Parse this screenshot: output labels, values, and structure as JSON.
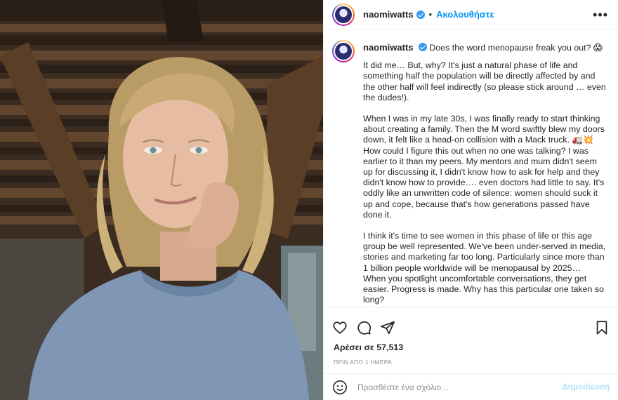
{
  "post": {
    "username": "naomiwatts",
    "follow_label": "Ακολουθήστε",
    "dot": "•",
    "more": "•••"
  },
  "caption": {
    "username": "naomiwatts",
    "first_line": "Does the word menopause freak you out? 😱",
    "paragraphs": [
      "It did me… But, why? It's just a natural phase of life and something half the population will be directly affected by and the other half will feel indirectly (so please stick around … even the dudes!).",
      "When I was in my late 30s, I was finally ready to start thinking about creating a family. Then the M word swiftly blew my doors down, it felt like a head-on collision with a Mack truck. 🚛💥 How could I figure this out when no one was talking? I was earlier to it than my peers. My mentors and mum didn't seem up for discussing it, I didn't know how to ask for help and they didn't know how to provide…. even doctors had little to say. It's oddly like an unwritten code of silence: women should suck it up and cope, because that's how generations passed have done it.",
      "I think it's time to see women in this phase of life or this age group be well represented. We've been under-served in media, stories and marketing far too long. Particularly since more than 1 billion people worldwide will be menopausal by 2025…\nWhen you spotlight uncomfortable conversations, they get easier. Progress is made. Why has this particular one taken so long?"
    ]
  },
  "actions": {
    "likes": "Αρέσει σε 57,513",
    "time": "ΠΡΙΝ ΑΠΟ 1 ΗΜΕΡΑ"
  },
  "comment": {
    "placeholder": "Προσθέστε ένα σχόλιο...",
    "post_label": "Δημοσίευση"
  },
  "icons": {
    "like": "heart-icon",
    "comment": "comment-icon",
    "share": "share-icon",
    "save": "bookmark-icon",
    "emoji": "emoji-icon"
  },
  "colors": {
    "accent": "#0095f6",
    "verified": "#3897f0",
    "post_disabled": "#b2dffc"
  }
}
